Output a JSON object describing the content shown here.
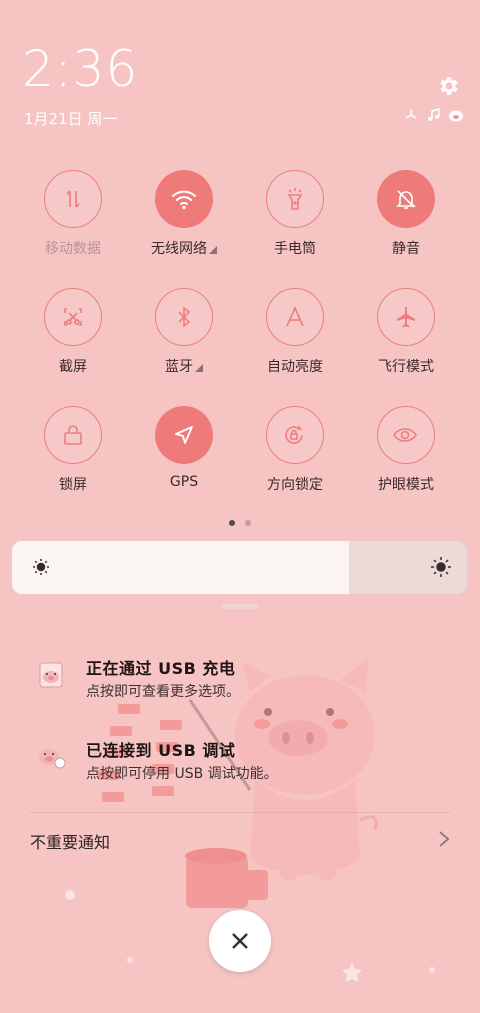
{
  "header": {
    "time": "2:36",
    "date": "1月21日 周一"
  },
  "quick_settings": [
    {
      "label": "移动数据",
      "state": "off",
      "icon": "mobile-data-icon",
      "has_menu": false,
      "dim": true
    },
    {
      "label": "无线网络",
      "state": "on",
      "icon": "wifi-icon",
      "has_menu": true,
      "dim": false
    },
    {
      "label": "手电筒",
      "state": "off",
      "icon": "flashlight-icon",
      "has_menu": false,
      "dim": false
    },
    {
      "label": "静音",
      "state": "on",
      "icon": "mute-bell-icon",
      "has_menu": false,
      "dim": false
    },
    {
      "label": "截屏",
      "state": "off",
      "icon": "screenshot-icon",
      "has_menu": false,
      "dim": false
    },
    {
      "label": "蓝牙",
      "state": "off",
      "icon": "bluetooth-icon",
      "has_menu": true,
      "dim": false
    },
    {
      "label": "自动亮度",
      "state": "off",
      "icon": "auto-brightness-icon",
      "has_menu": false,
      "dim": false
    },
    {
      "label": "飞行模式",
      "state": "off",
      "icon": "airplane-icon",
      "has_menu": false,
      "dim": false
    },
    {
      "label": "锁屏",
      "state": "off",
      "icon": "lock-icon",
      "has_menu": false,
      "dim": false
    },
    {
      "label": "GPS",
      "state": "on",
      "icon": "gps-icon",
      "has_menu": false,
      "dim": false
    },
    {
      "label": "方向锁定",
      "state": "off",
      "icon": "rotation-lock-icon",
      "has_menu": false,
      "dim": false
    },
    {
      "label": "护眼模式",
      "state": "off",
      "icon": "eye-icon",
      "has_menu": false,
      "dim": false
    }
  ],
  "pager": {
    "pages": 2,
    "current": 1
  },
  "brightness": {
    "level": 0.74
  },
  "notifications": [
    {
      "title": "正在通过 USB 充电",
      "subtitle": "点按即可查看更多选项。",
      "icon": "pig-usb-icon"
    },
    {
      "title": "已连接到 USB 调试",
      "subtitle": "点按即可停用 USB 调试功能。",
      "icon": "pig-debug-icon"
    }
  ],
  "unimportant": {
    "label": "不重要通知"
  },
  "colors": {
    "background": "#f6c4c3",
    "accent": "#ef7a7a",
    "panel": "#fbf6f1"
  }
}
